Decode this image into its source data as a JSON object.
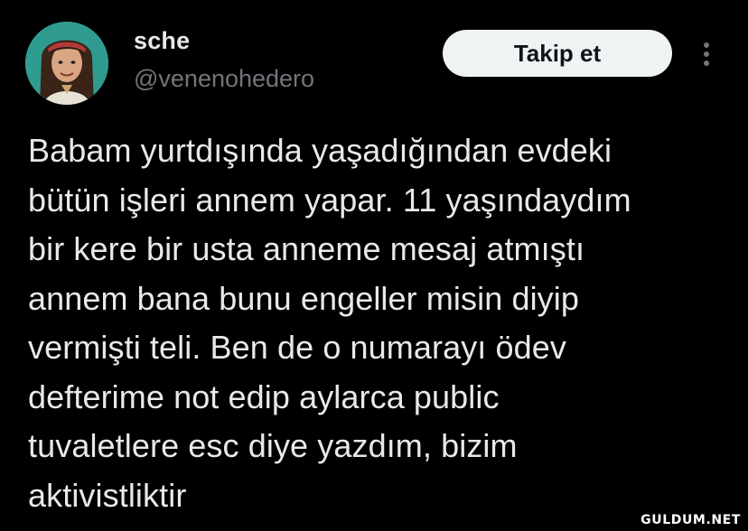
{
  "author": {
    "display_name": "sche",
    "handle": "@venenohedero",
    "avatar_icon": "profile-photo"
  },
  "actions": {
    "follow_label": "Takip et",
    "more_icon": "more-vertical-icon"
  },
  "tweet": {
    "text": "Babam yurtdışında yaşadığından evdeki\nbütün işleri annem yapar. 11 yaşındaydım\nbir kere bir usta anneme mesaj atmıştı\nannem bana bunu engeller misin diyip\nvermişti teli. Ben de o numarayı ödev\ndefterime not edip aylarca public\ntuvaletlere esc diye yazdım, bizim\naktivistliktir"
  },
  "watermark": {
    "text": "GULDUM.NET"
  },
  "colors": {
    "background": "#000000",
    "text_primary": "#e7e9ea",
    "text_secondary": "#71767b",
    "button_bg": "#eff3f4",
    "button_text": "#0f1419"
  }
}
